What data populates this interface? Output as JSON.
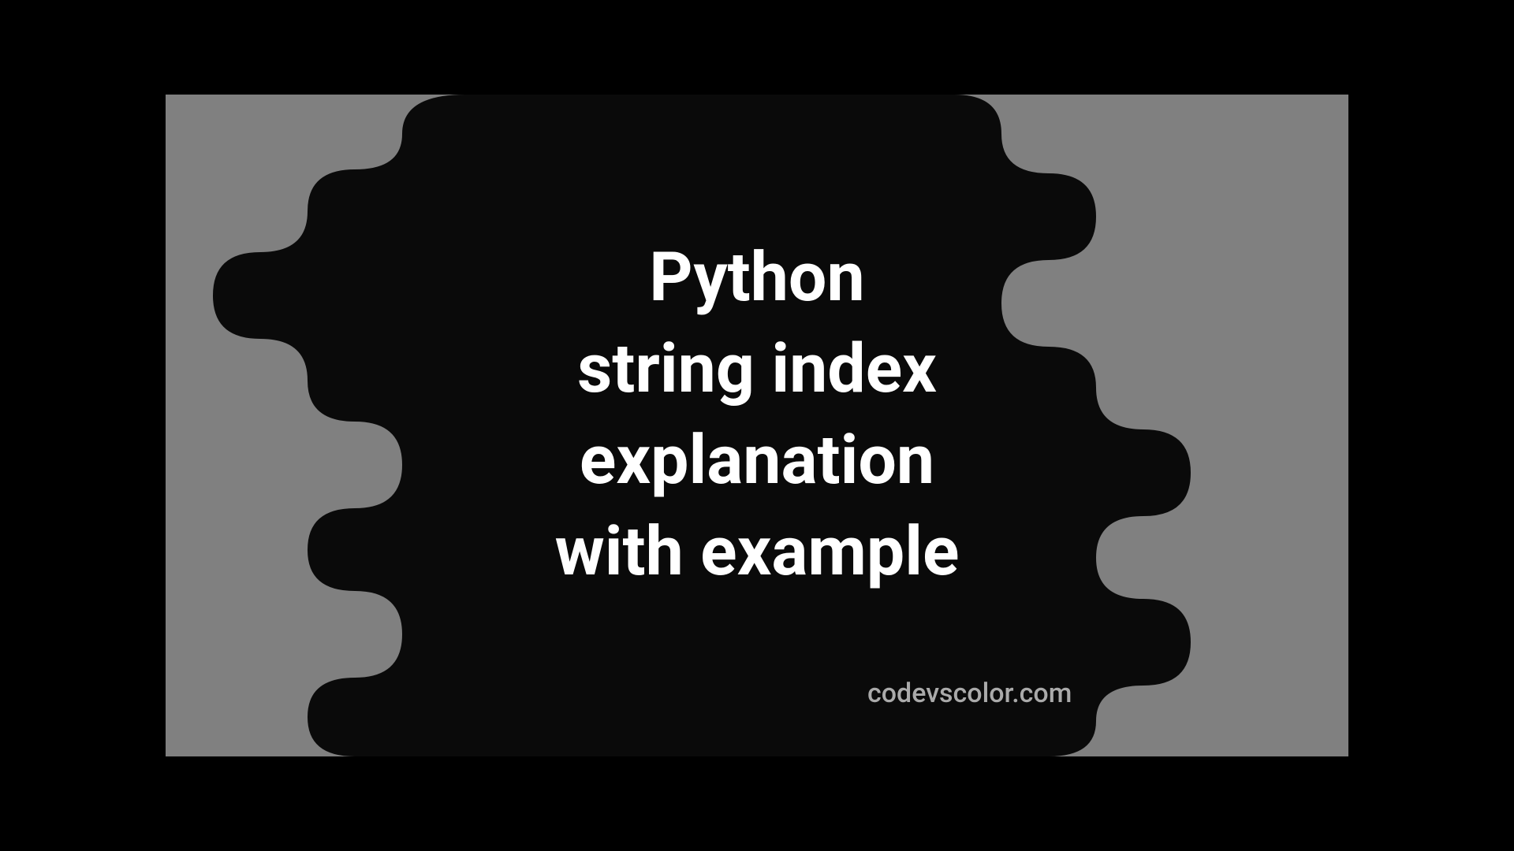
{
  "title": "Python\nstring index\nexplanation\nwith example",
  "watermark": "codevscolor.com",
  "colors": {
    "background_outer": "#808080",
    "background_inner": "#0a0a0a",
    "text": "#ffffff",
    "watermark": "#aaaaaa"
  }
}
